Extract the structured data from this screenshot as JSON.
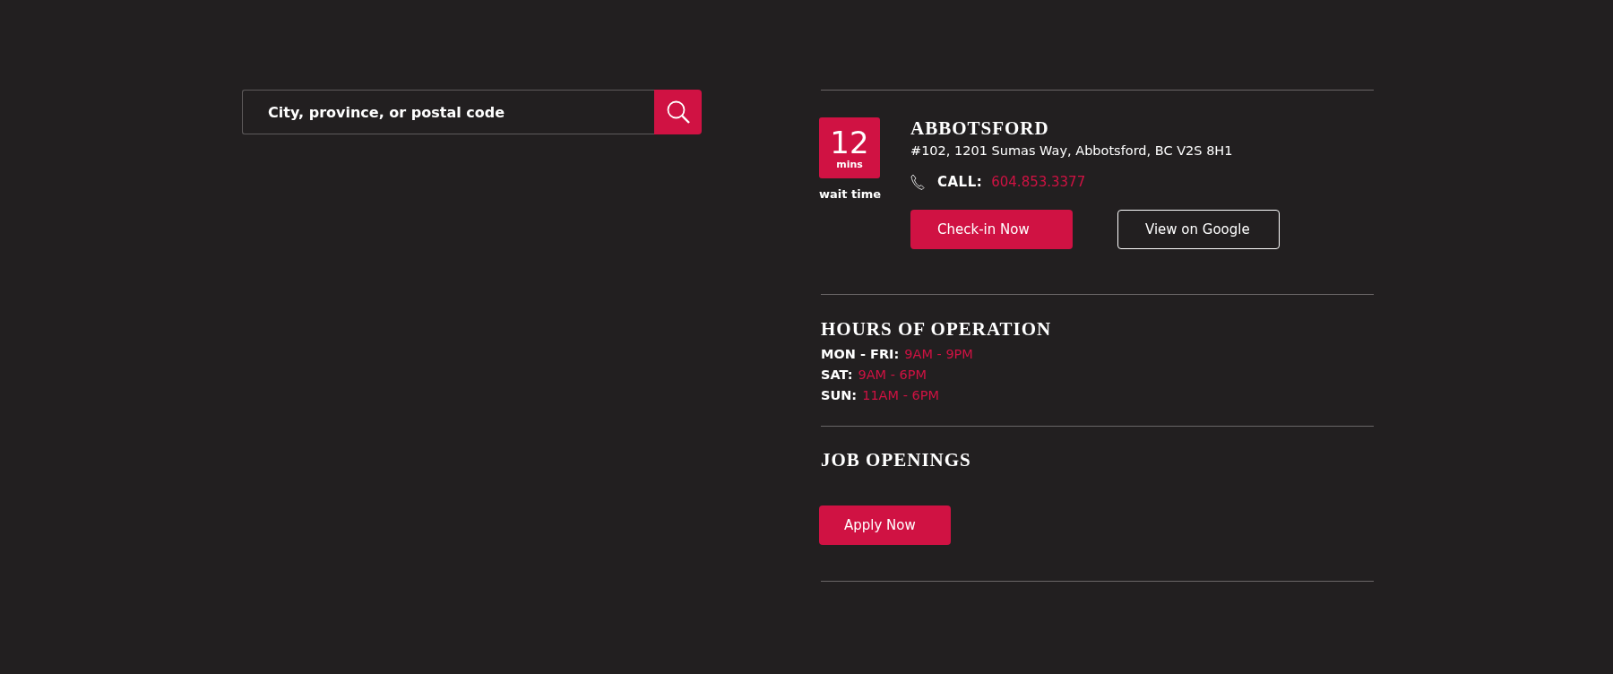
{
  "search": {
    "placeholder": "City, province, or postal code"
  },
  "location": {
    "wait": {
      "value": "12",
      "unit": "mins",
      "caption": "wait time"
    },
    "name": "ABBOTSFORD",
    "address": "#102, 1201 Sumas Way, Abbotsford, BC V2S 8H1",
    "call_label": "CALL:",
    "phone": "604.853.3377",
    "buttons": [
      {
        "label": "Check-in Now",
        "kind": "primary"
      },
      {
        "label": "View on Google",
        "kind": "outline"
      }
    ]
  },
  "hours": {
    "title": "HOURS OF OPERATION",
    "rows": [
      {
        "day": "MON - FRI:",
        "time": "9AM - 9PM"
      },
      {
        "day": "SAT:",
        "time": "9AM - 6PM"
      },
      {
        "day": "SUN:",
        "time": "11AM - 6PM"
      }
    ]
  },
  "jobs": {
    "title": "JOB OPENINGS",
    "button": "Apply Now"
  }
}
